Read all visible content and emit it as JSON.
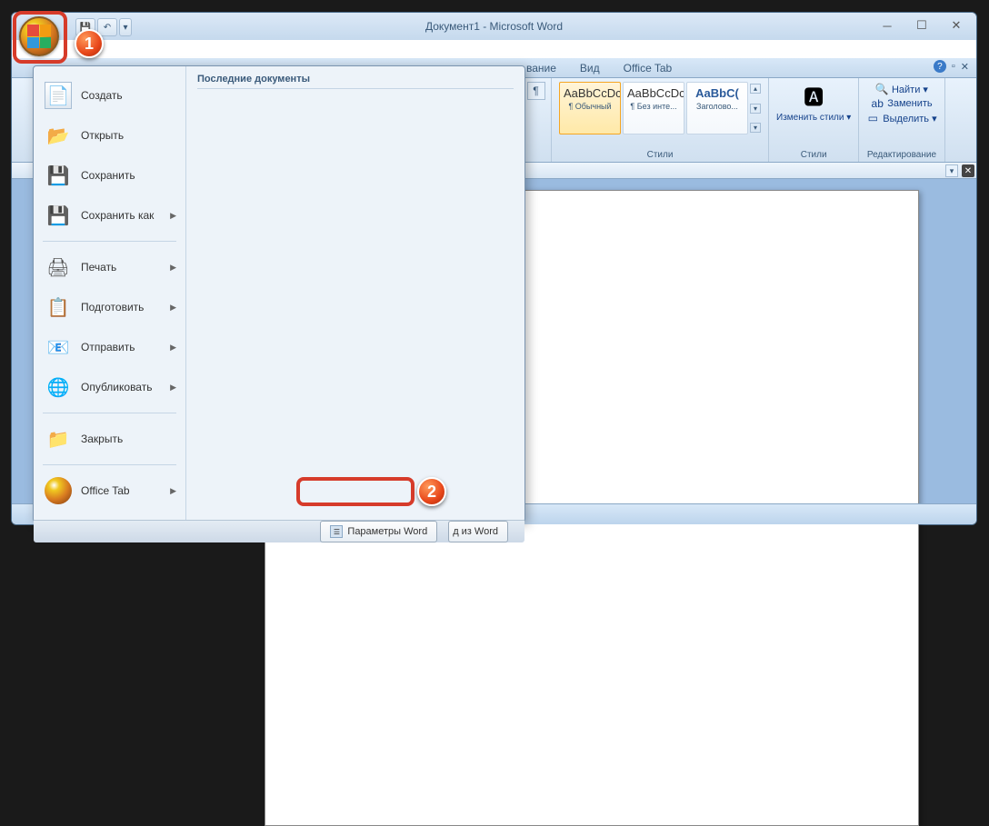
{
  "window": {
    "title": "Документ1 - Microsoft Word"
  },
  "ribbon_tabs": {
    "partial1": "вание",
    "view": "Вид",
    "office_tab": "Office Tab"
  },
  "ribbon": {
    "paragraph_mark": "¶",
    "styles": {
      "s1_preview": "AaBbCcDc",
      "s1_name": "¶ Обычный",
      "s2_preview": "AaBbCcDc",
      "s2_name": "¶ Без инте...",
      "s3_preview": "AaBbC(",
      "s3_name": "Заголово...",
      "group_label": "Стили",
      "change_label": "Изменить стили ▾"
    },
    "editing": {
      "find": "Найти ▾",
      "replace": "Заменить",
      "select": "Выделить ▾",
      "group_label": "Редактирование"
    }
  },
  "office_menu": {
    "recent_header": "Последние документы",
    "items": {
      "new": "Создать",
      "open": "Открыть",
      "save": "Сохранить",
      "save_as": "Сохранить как",
      "print": "Печать",
      "prepare": "Подготовить",
      "send": "Отправить",
      "publish": "Опубликовать",
      "close": "Закрыть",
      "office_tab": "Office Tab"
    },
    "footer": {
      "options": "Параметры Word",
      "exit_partial": "д из Word"
    }
  },
  "annotations": {
    "badge1": "1",
    "badge2": "2"
  }
}
